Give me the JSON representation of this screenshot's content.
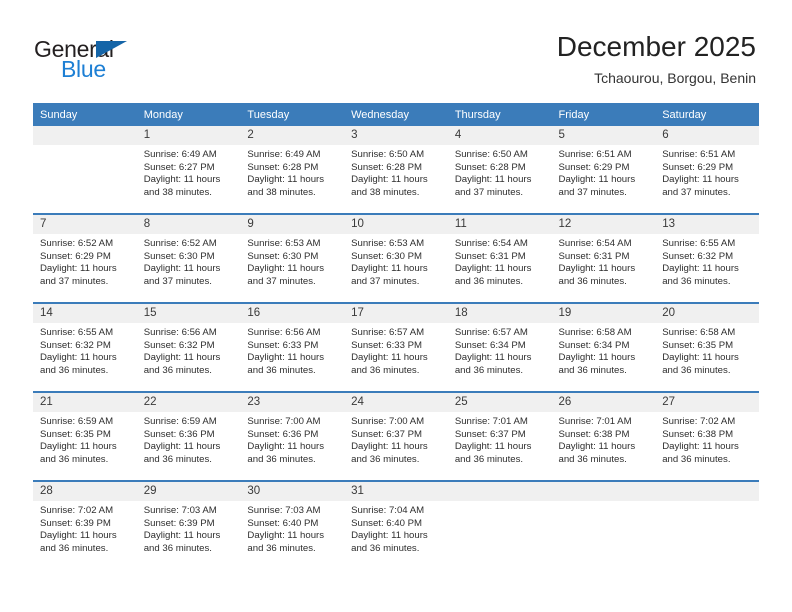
{
  "brand": {
    "name_top": "General",
    "name_bottom": "Blue",
    "triangle_color": "#1565a8",
    "blue_color": "#1d7fd4"
  },
  "header": {
    "month_title": "December 2025",
    "location": "Tchaourou, Borgou, Benin"
  },
  "theme": {
    "header_row_bg": "#3b7cba",
    "daynum_bg": "#f0f0f0",
    "cell_bg": "#ffffff",
    "text": "#2e2e2e"
  },
  "weekday_headers": [
    "Sunday",
    "Monday",
    "Tuesday",
    "Wednesday",
    "Thursday",
    "Friday",
    "Saturday"
  ],
  "labels": {
    "sunrise_prefix": "Sunrise:",
    "sunset_prefix": "Sunset:",
    "daylight_prefix": "Daylight:"
  },
  "weeks": [
    [
      {
        "day": "",
        "empty": true,
        "sunrise": "",
        "sunset": "",
        "daylight_line1": "",
        "daylight_line2": ""
      },
      {
        "day": "1",
        "sunrise": "Sunrise: 6:49 AM",
        "sunset": "Sunset: 6:27 PM",
        "daylight_line1": "Daylight: 11 hours",
        "daylight_line2": "and 38 minutes."
      },
      {
        "day": "2",
        "sunrise": "Sunrise: 6:49 AM",
        "sunset": "Sunset: 6:28 PM",
        "daylight_line1": "Daylight: 11 hours",
        "daylight_line2": "and 38 minutes."
      },
      {
        "day": "3",
        "sunrise": "Sunrise: 6:50 AM",
        "sunset": "Sunset: 6:28 PM",
        "daylight_line1": "Daylight: 11 hours",
        "daylight_line2": "and 38 minutes."
      },
      {
        "day": "4",
        "sunrise": "Sunrise: 6:50 AM",
        "sunset": "Sunset: 6:28 PM",
        "daylight_line1": "Daylight: 11 hours",
        "daylight_line2": "and 37 minutes."
      },
      {
        "day": "5",
        "sunrise": "Sunrise: 6:51 AM",
        "sunset": "Sunset: 6:29 PM",
        "daylight_line1": "Daylight: 11 hours",
        "daylight_line2": "and 37 minutes."
      },
      {
        "day": "6",
        "sunrise": "Sunrise: 6:51 AM",
        "sunset": "Sunset: 6:29 PM",
        "daylight_line1": "Daylight: 11 hours",
        "daylight_line2": "and 37 minutes."
      }
    ],
    [
      {
        "day": "7",
        "sunrise": "Sunrise: 6:52 AM",
        "sunset": "Sunset: 6:29 PM",
        "daylight_line1": "Daylight: 11 hours",
        "daylight_line2": "and 37 minutes."
      },
      {
        "day": "8",
        "sunrise": "Sunrise: 6:52 AM",
        "sunset": "Sunset: 6:30 PM",
        "daylight_line1": "Daylight: 11 hours",
        "daylight_line2": "and 37 minutes."
      },
      {
        "day": "9",
        "sunrise": "Sunrise: 6:53 AM",
        "sunset": "Sunset: 6:30 PM",
        "daylight_line1": "Daylight: 11 hours",
        "daylight_line2": "and 37 minutes."
      },
      {
        "day": "10",
        "sunrise": "Sunrise: 6:53 AM",
        "sunset": "Sunset: 6:30 PM",
        "daylight_line1": "Daylight: 11 hours",
        "daylight_line2": "and 37 minutes."
      },
      {
        "day": "11",
        "sunrise": "Sunrise: 6:54 AM",
        "sunset": "Sunset: 6:31 PM",
        "daylight_line1": "Daylight: 11 hours",
        "daylight_line2": "and 36 minutes."
      },
      {
        "day": "12",
        "sunrise": "Sunrise: 6:54 AM",
        "sunset": "Sunset: 6:31 PM",
        "daylight_line1": "Daylight: 11 hours",
        "daylight_line2": "and 36 minutes."
      },
      {
        "day": "13",
        "sunrise": "Sunrise: 6:55 AM",
        "sunset": "Sunset: 6:32 PM",
        "daylight_line1": "Daylight: 11 hours",
        "daylight_line2": "and 36 minutes."
      }
    ],
    [
      {
        "day": "14",
        "sunrise": "Sunrise: 6:55 AM",
        "sunset": "Sunset: 6:32 PM",
        "daylight_line1": "Daylight: 11 hours",
        "daylight_line2": "and 36 minutes."
      },
      {
        "day": "15",
        "sunrise": "Sunrise: 6:56 AM",
        "sunset": "Sunset: 6:32 PM",
        "daylight_line1": "Daylight: 11 hours",
        "daylight_line2": "and 36 minutes."
      },
      {
        "day": "16",
        "sunrise": "Sunrise: 6:56 AM",
        "sunset": "Sunset: 6:33 PM",
        "daylight_line1": "Daylight: 11 hours",
        "daylight_line2": "and 36 minutes."
      },
      {
        "day": "17",
        "sunrise": "Sunrise: 6:57 AM",
        "sunset": "Sunset: 6:33 PM",
        "daylight_line1": "Daylight: 11 hours",
        "daylight_line2": "and 36 minutes."
      },
      {
        "day": "18",
        "sunrise": "Sunrise: 6:57 AM",
        "sunset": "Sunset: 6:34 PM",
        "daylight_line1": "Daylight: 11 hours",
        "daylight_line2": "and 36 minutes."
      },
      {
        "day": "19",
        "sunrise": "Sunrise: 6:58 AM",
        "sunset": "Sunset: 6:34 PM",
        "daylight_line1": "Daylight: 11 hours",
        "daylight_line2": "and 36 minutes."
      },
      {
        "day": "20",
        "sunrise": "Sunrise: 6:58 AM",
        "sunset": "Sunset: 6:35 PM",
        "daylight_line1": "Daylight: 11 hours",
        "daylight_line2": "and 36 minutes."
      }
    ],
    [
      {
        "day": "21",
        "sunrise": "Sunrise: 6:59 AM",
        "sunset": "Sunset: 6:35 PM",
        "daylight_line1": "Daylight: 11 hours",
        "daylight_line2": "and 36 minutes."
      },
      {
        "day": "22",
        "sunrise": "Sunrise: 6:59 AM",
        "sunset": "Sunset: 6:36 PM",
        "daylight_line1": "Daylight: 11 hours",
        "daylight_line2": "and 36 minutes."
      },
      {
        "day": "23",
        "sunrise": "Sunrise: 7:00 AM",
        "sunset": "Sunset: 6:36 PM",
        "daylight_line1": "Daylight: 11 hours",
        "daylight_line2": "and 36 minutes."
      },
      {
        "day": "24",
        "sunrise": "Sunrise: 7:00 AM",
        "sunset": "Sunset: 6:37 PM",
        "daylight_line1": "Daylight: 11 hours",
        "daylight_line2": "and 36 minutes."
      },
      {
        "day": "25",
        "sunrise": "Sunrise: 7:01 AM",
        "sunset": "Sunset: 6:37 PM",
        "daylight_line1": "Daylight: 11 hours",
        "daylight_line2": "and 36 minutes."
      },
      {
        "day": "26",
        "sunrise": "Sunrise: 7:01 AM",
        "sunset": "Sunset: 6:38 PM",
        "daylight_line1": "Daylight: 11 hours",
        "daylight_line2": "and 36 minutes."
      },
      {
        "day": "27",
        "sunrise": "Sunrise: 7:02 AM",
        "sunset": "Sunset: 6:38 PM",
        "daylight_line1": "Daylight: 11 hours",
        "daylight_line2": "and 36 minutes."
      }
    ],
    [
      {
        "day": "28",
        "sunrise": "Sunrise: 7:02 AM",
        "sunset": "Sunset: 6:39 PM",
        "daylight_line1": "Daylight: 11 hours",
        "daylight_line2": "and 36 minutes."
      },
      {
        "day": "29",
        "sunrise": "Sunrise: 7:03 AM",
        "sunset": "Sunset: 6:39 PM",
        "daylight_line1": "Daylight: 11 hours",
        "daylight_line2": "and 36 minutes."
      },
      {
        "day": "30",
        "sunrise": "Sunrise: 7:03 AM",
        "sunset": "Sunset: 6:40 PM",
        "daylight_line1": "Daylight: 11 hours",
        "daylight_line2": "and 36 minutes."
      },
      {
        "day": "31",
        "sunrise": "Sunrise: 7:04 AM",
        "sunset": "Sunset: 6:40 PM",
        "daylight_line1": "Daylight: 11 hours",
        "daylight_line2": "and 36 minutes."
      },
      {
        "day": "",
        "empty": true,
        "sunrise": "",
        "sunset": "",
        "daylight_line1": "",
        "daylight_line2": ""
      },
      {
        "day": "",
        "empty": true,
        "sunrise": "",
        "sunset": "",
        "daylight_line1": "",
        "daylight_line2": ""
      },
      {
        "day": "",
        "empty": true,
        "sunrise": "",
        "sunset": "",
        "daylight_line1": "",
        "daylight_line2": ""
      }
    ]
  ]
}
